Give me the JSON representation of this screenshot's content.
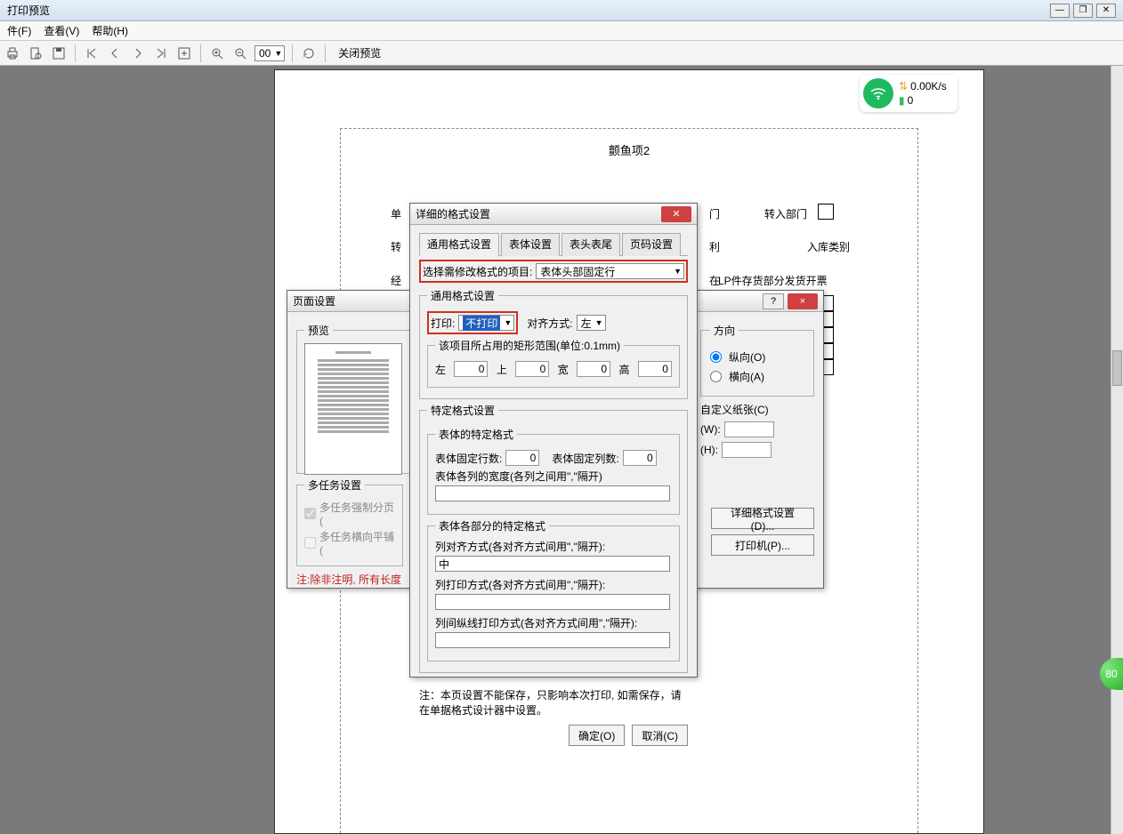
{
  "window": {
    "title": "打印预览"
  },
  "menubar": {
    "file": "件(F)",
    "view": "查看(V)",
    "help": "帮助(H)"
  },
  "toolbar": {
    "zoom_value": "00",
    "close_preview": "关闭预览"
  },
  "preview_doc": {
    "title": "颤鱼项2",
    "field_dan": "单",
    "field_zhuan": "转",
    "field_jing": "经",
    "field_men": "门",
    "field_li": "利",
    "field_zai": "在",
    "dept_label": "转入部门",
    "cat_label": "入库类别",
    "lp_label": "LP件存货部分发货开票"
  },
  "wifi": {
    "speed": "0.00K/s",
    "count": "0"
  },
  "green": {
    "num": "80"
  },
  "page_setup": {
    "title": "页面设置",
    "preview_legend": "预览",
    "multi_legend": "多任务设置",
    "chk_force_page": "多任务强制分页(",
    "chk_horiz_tile": "多任务横向平铺(",
    "note": "注:除非注明, 所有长度",
    "orient_legend": "方向",
    "portrait": "纵向(O)",
    "landscape": "横向(A)",
    "custom_paper": "自定义纸张(C)",
    "w_label": "(W):",
    "h_label": "(H):",
    "btn_detail": "详细格式设置(D)...",
    "btn_printer": "打印机(P)...",
    "help": "?",
    "close": "×"
  },
  "detail": {
    "title": "详细的格式设置",
    "tabs": {
      "t1": "通用格式设置",
      "t2": "表体设置",
      "t3": "表头表尾",
      "t4": "页码设置"
    },
    "select_label": "选择需修改格式的项目:",
    "select_value": "表体头部固定行",
    "general_legend": "通用格式设置",
    "print_label": "打印:",
    "print_value": "不打印",
    "align_label": "对齐方式:",
    "align_value": "左",
    "rect_legend": "该项目所占用的矩形范围(单位:0.1mm)",
    "left": "左",
    "top": "上",
    "width": "宽",
    "height": "高",
    "left_v": "0",
    "top_v": "0",
    "width_v": "0",
    "height_v": "0",
    "specific_legend": "特定格式设置",
    "body_spec_legend": "表体的特定格式",
    "fixed_rows_label": "表体固定行数:",
    "fixed_rows_v": "0",
    "fixed_cols_label": "表体固定列数:",
    "fixed_cols_v": "0",
    "col_width_label": "表体各列的宽度(各列之间用\",\"隔开)",
    "parts_legend": "表体各部分的特定格式",
    "col_align_label": "列对齐方式(各对齐方式间用\",\"隔开):",
    "col_align_v": "中",
    "col_print_label": "列打印方式(各对齐方式间用\",\"隔开):",
    "col_vline_label": "列间纵线打印方式(各对齐方式间用\",\"隔开):",
    "footnote": "注：本页设置不能保存，只影响本次打印, 如需保存，请在单据格式设计器中设置。",
    "ok": "确定(O)",
    "cancel": "取消(C)"
  }
}
